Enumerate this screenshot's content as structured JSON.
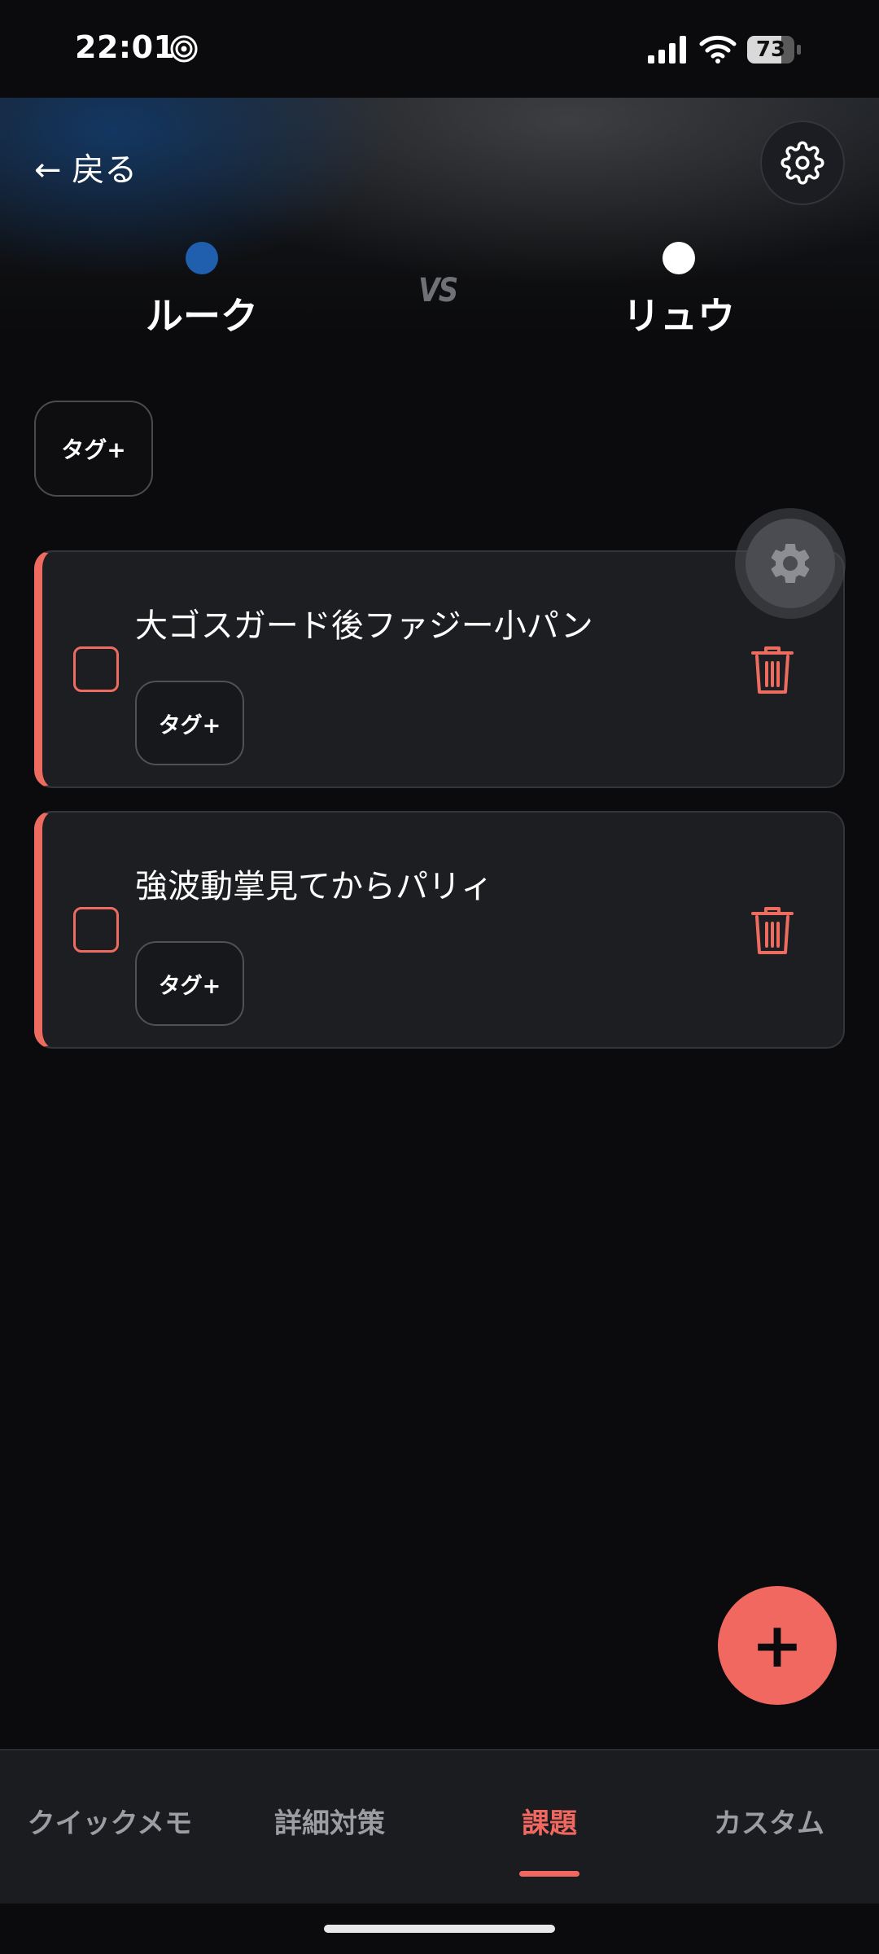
{
  "status_bar": {
    "time": "22:01",
    "battery": "73"
  },
  "header": {
    "back_label": "← 戻る",
    "vs_label": "VS",
    "player_left": {
      "name": "ルーク",
      "color": "#1f5fad"
    },
    "player_right": {
      "name": "リュウ",
      "color": "#ffffff"
    }
  },
  "filter": {
    "tag_label": "タグ+"
  },
  "tasks": [
    {
      "title": "大ゴスガード後ファジー小パン",
      "tag_label": "タグ+",
      "checked": false
    },
    {
      "title": "強波動掌見てからパリィ",
      "tag_label": "タグ+",
      "checked": false
    }
  ],
  "fab_label": "+",
  "nav": {
    "items": [
      {
        "label": "クイックメモ"
      },
      {
        "label": "詳細対策"
      },
      {
        "label": "課題"
      },
      {
        "label": "カスタム"
      }
    ],
    "active": "課題"
  },
  "colors": {
    "accent": "#f06860",
    "card_bg": "#1d1e22",
    "background": "#0b0b0d"
  }
}
